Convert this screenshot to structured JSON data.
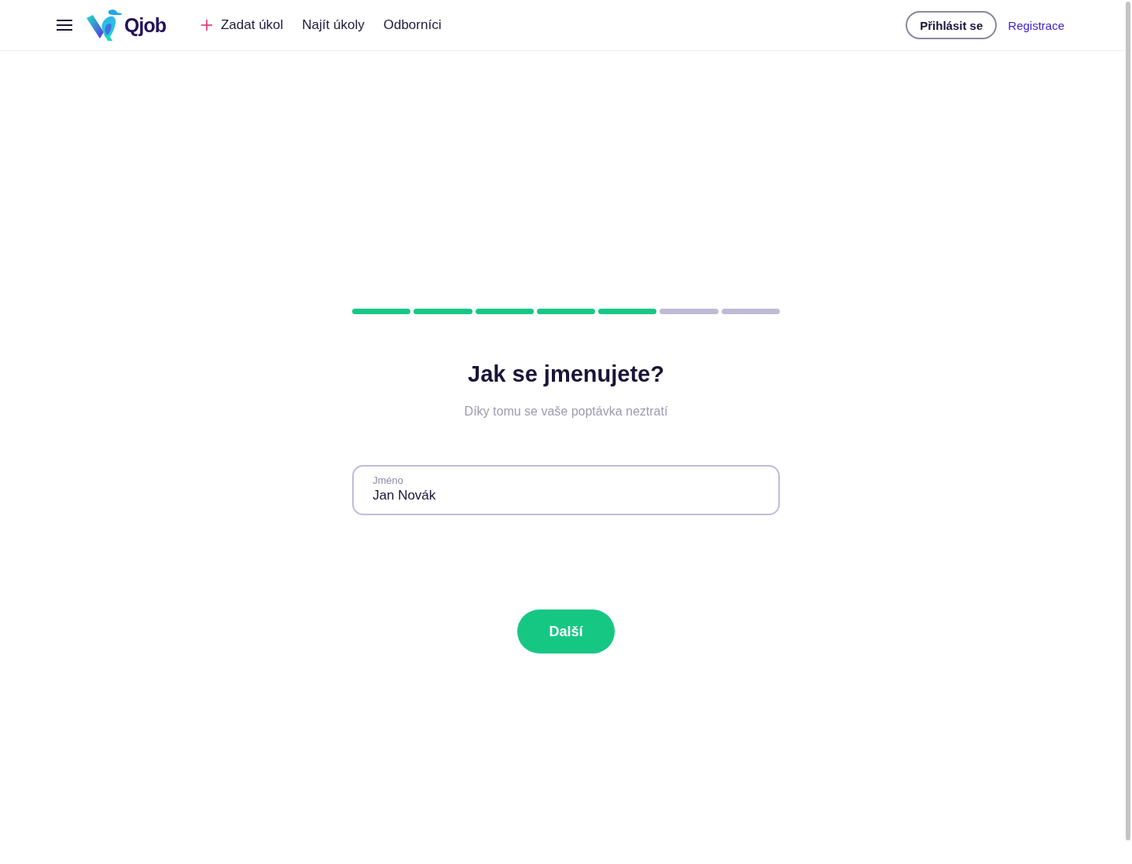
{
  "header": {
    "brand": "Qjob",
    "nav": [
      {
        "label": "Zadat úkol",
        "kind": "action"
      },
      {
        "label": "Najít úkoly",
        "kind": "link"
      },
      {
        "label": "Odborníci",
        "kind": "link"
      }
    ],
    "login_button": "Přihlásit se",
    "register_link": "Registrace"
  },
  "progress": {
    "steps": [
      {
        "completed": true
      },
      {
        "completed": true
      },
      {
        "completed": true
      },
      {
        "completed": true
      },
      {
        "completed": true
      },
      {
        "completed": false
      },
      {
        "completed": false
      }
    ]
  },
  "form": {
    "title": "Jak se jmenujete?",
    "subtitle": "Díky tomu se vaše poptávka neztratí",
    "field": {
      "label": "Jméno",
      "value": "Jan Novák"
    },
    "next_button": "Další"
  }
}
